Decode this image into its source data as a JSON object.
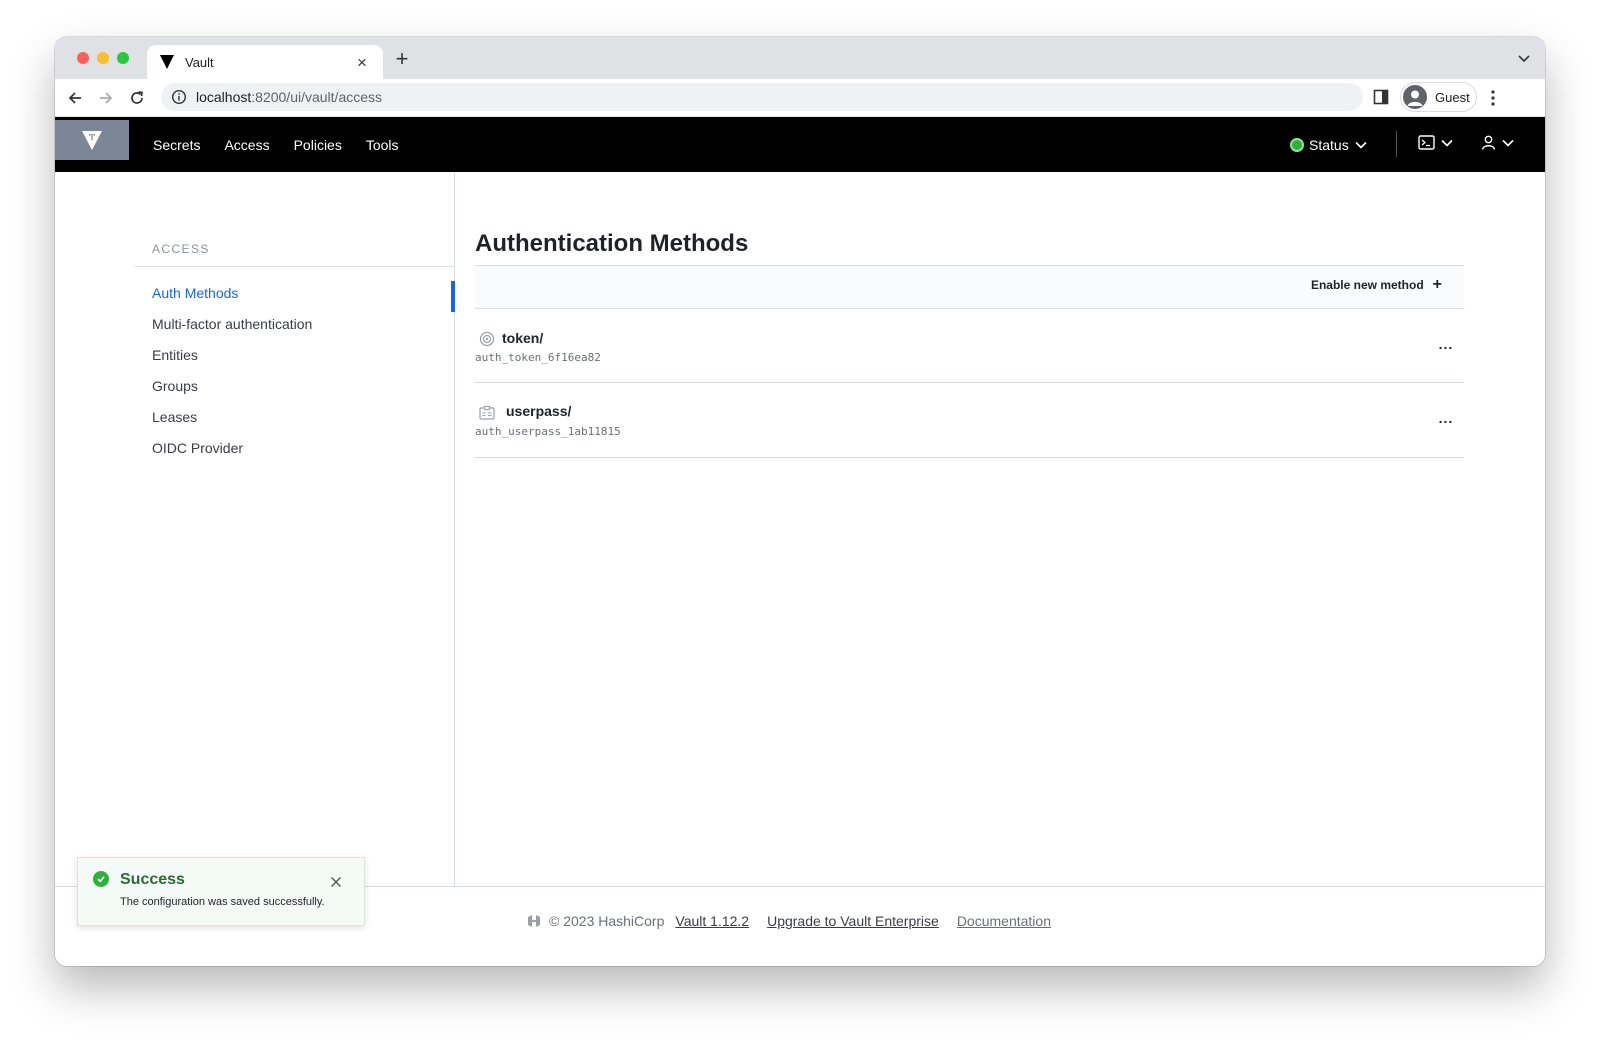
{
  "browser": {
    "tab_title": "Vault",
    "url_host": "localhost",
    "url_rest": ":8200/ui/vault/access",
    "profile_label": "Guest"
  },
  "nav": {
    "links": [
      "Secrets",
      "Access",
      "Policies",
      "Tools"
    ],
    "status_label": "Status",
    "status_color": "#2eb039"
  },
  "sidebar": {
    "heading": "ACCESS",
    "items": [
      {
        "label": "Auth Methods",
        "active": true
      },
      {
        "label": "Multi-factor authentication"
      },
      {
        "label": "Entities"
      },
      {
        "label": "Groups"
      },
      {
        "label": "Leases"
      },
      {
        "label": "OIDC Provider"
      }
    ],
    "accent": "#1563ff"
  },
  "main": {
    "title": "Authentication Methods",
    "enable_button": "Enable new method",
    "methods": [
      {
        "path": "token/",
        "accessor": "auth_token_6f16ea82",
        "icon": "token-icon"
      },
      {
        "path": "userpass/",
        "accessor": "auth_userpass_1ab11815",
        "icon": "userpass-icon"
      }
    ],
    "row_menu_label": "..."
  },
  "footer": {
    "copyright": "© 2023 HashiCorp",
    "version": "Vault 1.12.2",
    "upgrade": "Upgrade to Vault Enterprise",
    "docs": "Documentation"
  },
  "toast": {
    "title": "Success",
    "message": "The configuration was saved successfully.",
    "color": "#2eb039"
  }
}
